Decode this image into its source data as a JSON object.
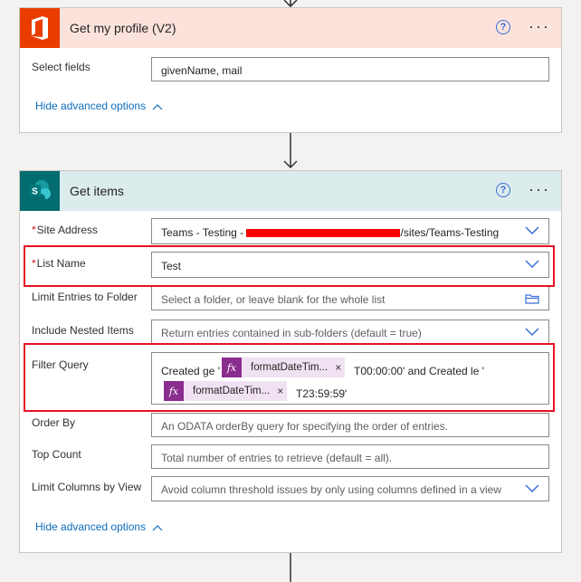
{
  "card1": {
    "title": "Get my profile (V2)",
    "select_fields_label": "Select fields",
    "select_fields_value": "givenName, mail",
    "hide_advanced": "Hide advanced options"
  },
  "card2": {
    "title": "Get items",
    "site_address": {
      "required_mark": "*",
      "label": "Site Address",
      "value_prefix": "Teams - Testing - ",
      "value_suffix": "/sites/Teams-Testing"
    },
    "list_name": {
      "required_mark": "*",
      "label": "List Name",
      "value": "Test"
    },
    "limit_folder": {
      "label": "Limit Entries to Folder",
      "placeholder": "Select a folder, or leave blank for the whole list"
    },
    "nested_items": {
      "label": "Include Nested Items",
      "value": "Return entries contained in sub-folders (default = true)"
    },
    "filter_query": {
      "label": "Filter Query",
      "text1": "Created ge '",
      "token1": "formatDateTim...",
      "text2": "T00:00:00' and Created le '",
      "token2": "formatDateTim...",
      "text3": "T23:59:59'",
      "fx_glyph": "fx",
      "close_glyph": "×"
    },
    "order_by": {
      "label": "Order By",
      "placeholder": "An ODATA orderBy query for specifying the order of entries."
    },
    "top_count": {
      "label": "Top Count",
      "placeholder": "Total number of entries to retrieve (default = all)."
    },
    "limit_view": {
      "label": "Limit Columns by View",
      "placeholder": "Avoid column threshold issues by only using columns defined in a view"
    },
    "hide_advanced": "Hide advanced options"
  },
  "common": {
    "help_glyph": "?",
    "more_glyph": "···"
  },
  "colors": {
    "office_brand": "#eb3c00",
    "sharepoint_brand": "#036c70",
    "highlight": "#e81123",
    "link": "#0f6cbd",
    "fx_token": "#8a2d8f"
  }
}
